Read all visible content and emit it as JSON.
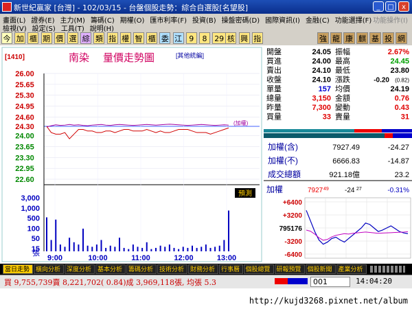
{
  "window": {
    "title": "新世紀贏家 [台灣] - 102/03/15 - 台盤個股走勢：綜合自選股[名望股]",
    "buttons": [
      "_",
      "□",
      "x"
    ]
  },
  "menu": {
    "row1": [
      "畫面(L)",
      "證券(E)",
      "主力(M)",
      "籌碼(C)",
      "期權(O)",
      "匯市利率(F)",
      "投資(B)",
      "操盤密碼(D)",
      "國際資訊(I)",
      "金融(C)",
      "功能選擇(F)"
    ],
    "row1_right": "功能操作(I)",
    "row2": [
      "檢視(V)",
      "設定(S)",
      "工具(T)",
      "說明(H)"
    ]
  },
  "toolbar": {
    "left_items": [
      "今",
      "加",
      "櫃",
      "期",
      "價",
      "選",
      "綜",
      "類",
      "指",
      "權",
      "智",
      "櫃",
      "委",
      "江",
      "9",
      "8",
      "29",
      "核",
      "興",
      "指"
    ],
    "right_items": [
      "強",
      "龍",
      "康",
      "麒",
      "基",
      "投",
      "網"
    ]
  },
  "chart": {
    "code": "[1410]",
    "name": "南染",
    "title": "量價走勢圖",
    "link": "[其他統編]",
    "annotation": "(加權)",
    "forecast_button": "預測",
    "vol_unit": "張"
  },
  "chart_data": {
    "type": "line",
    "price_ticks": [
      "26.00",
      "25.65",
      "25.30",
      "24.95",
      "24.60",
      "24.30",
      "24.00",
      "23.65",
      "23.30",
      "22.95",
      "22.60"
    ],
    "volume_ticks": [
      "3,000",
      "1,000",
      "500",
      "100",
      "50",
      "15"
    ],
    "x_ticks": [
      "9:00",
      "10:00",
      "11:00",
      "12:00",
      "13:00"
    ],
    "ref_price": 24.3,
    "ylim": [
      22.6,
      26.0
    ],
    "price_series": [
      24.3,
      24.1,
      24.05,
      24.05,
      24.1,
      23.9,
      24.05,
      24.2,
      24.2,
      24.15,
      24.15,
      24.1,
      24.1,
      24.15,
      24.15,
      24.1,
      24.15,
      24.2,
      24.2,
      24.15,
      24.15,
      24.15,
      24.2,
      24.15,
      24.1,
      24.15,
      24.1,
      24.1,
      24.15,
      24.2,
      24.2,
      24.2,
      24.15,
      24.1,
      24.1,
      24.1,
      24.05,
      24.1,
      24.15,
      24.2,
      24.25
    ],
    "index_series": [
      24.28,
      24.32,
      24.35,
      24.33,
      24.34,
      24.36,
      24.34,
      24.35,
      24.33,
      24.32,
      24.34,
      24.35,
      24.36,
      24.34,
      24.33,
      24.35,
      24.36,
      24.35,
      24.34,
      24.33,
      24.34,
      24.35,
      24.36,
      24.35,
      24.34,
      24.35,
      24.36,
      24.37,
      24.36,
      24.35,
      24.34,
      24.33,
      24.34,
      24.35,
      24.36,
      24.35,
      24.34,
      24.33,
      24.34,
      24.35,
      24.34
    ],
    "volumes": [
      30,
      10,
      28,
      6,
      4,
      12,
      8,
      6,
      20,
      5,
      4,
      6,
      10,
      3,
      5,
      4,
      12,
      3,
      2,
      6,
      4,
      3,
      8,
      2,
      3,
      5,
      4,
      6,
      3,
      2,
      4,
      3,
      5,
      3,
      4,
      6,
      3,
      4,
      5,
      10,
      36
    ]
  },
  "quote": {
    "rows": [
      {
        "l1": "開盤",
        "v1": "24.05",
        "l2": "振幅",
        "v2": "2.67%",
        "c2": "#e00000"
      },
      {
        "l1": "買進",
        "v1": "24.00",
        "l2": "最高",
        "v2": "24.45",
        "c2": "#00a000"
      },
      {
        "l1": "賣出",
        "v1": "24.10",
        "l2": "最低",
        "v2": "23.80",
        "c2": "#000000"
      },
      {
        "l1": "收盤",
        "v1": "24.10",
        "l2": "漲跌",
        "v2": "-0.20",
        "v2b": "(0.82)",
        "c2": "#000000"
      },
      {
        "l1": "單量",
        "v1": "157",
        "l2": "均價",
        "v2": "24.19",
        "c1": "#0000d0",
        "c2": "#000000"
      },
      {
        "l1": "總量",
        "v1": "3,150",
        "l2": "金額",
        "v2": "0.76",
        "c1": "#e00000",
        "c2": "#e00000"
      },
      {
        "l1": "昨量",
        "v1": "7,300",
        "l2": "變動",
        "v2": "0.43",
        "c1": "#e00000",
        "c2": "#e00000"
      },
      {
        "l1": "買量",
        "v1": "33",
        "l2": "賣量",
        "v2": "31",
        "c1": "#e00000",
        "c2": "#e00000"
      }
    ]
  },
  "index_panel": {
    "rows": [
      {
        "label": "加權(含)",
        "value": "7927.49",
        "change": "-24.27"
      },
      {
        "label": "加權(不)",
        "value": "6666.83",
        "change": "-14.87"
      },
      {
        "label": "成交總額",
        "value": "921.18億",
        "change": "23.2"
      }
    ]
  },
  "mini": {
    "label": "加權",
    "value": "7927",
    "value_dec": "49",
    "change": "-24",
    "change_dec": "27",
    "pct": "-0.31%",
    "ticks": [
      "+6400",
      "+3200",
      "795176",
      "-3200",
      "-6400"
    ]
  },
  "chart_data_mini": {
    "type": "line",
    "index_series": [
      7960,
      7945,
      7930,
      7918,
      7912,
      7915,
      7920,
      7922,
      7918,
      7915,
      7920,
      7925,
      7930,
      7935,
      7942,
      7940,
      7935,
      7930,
      7932,
      7935,
      7938,
      7934,
      7930,
      7928,
      7927
    ],
    "flow_series": [
      -500,
      -800,
      -1500,
      -2400,
      -3000,
      -2800,
      -2200,
      -1800,
      -1600,
      -1400,
      -1500,
      -1300,
      -1200,
      -1100,
      -1000,
      -1100,
      -1200,
      -1300,
      -1250,
      -1200,
      -1150,
      -1100,
      -1050,
      -1000,
      -900
    ]
  },
  "tabs": [
    "當日走勢",
    "橫向分析",
    "深度分析",
    "基本分析",
    "籌碼分析",
    "技術分析",
    "財務分析",
    "行事曆",
    "個股總覽",
    "研報預覽",
    "個股新聞",
    "產業分析"
  ],
  "status": {
    "left": "買 9,755,739賣 8,221,702( 0.84)成 3,969,118張, 均張 5.3",
    "field": "001",
    "time": "14:04:20"
  },
  "watermark": "http://kujd3268.pixnet.net/album",
  "colors": {
    "price": "#d00000",
    "index": "#a000a0",
    "ref": "#4060ff",
    "volume": "#0000c0"
  }
}
